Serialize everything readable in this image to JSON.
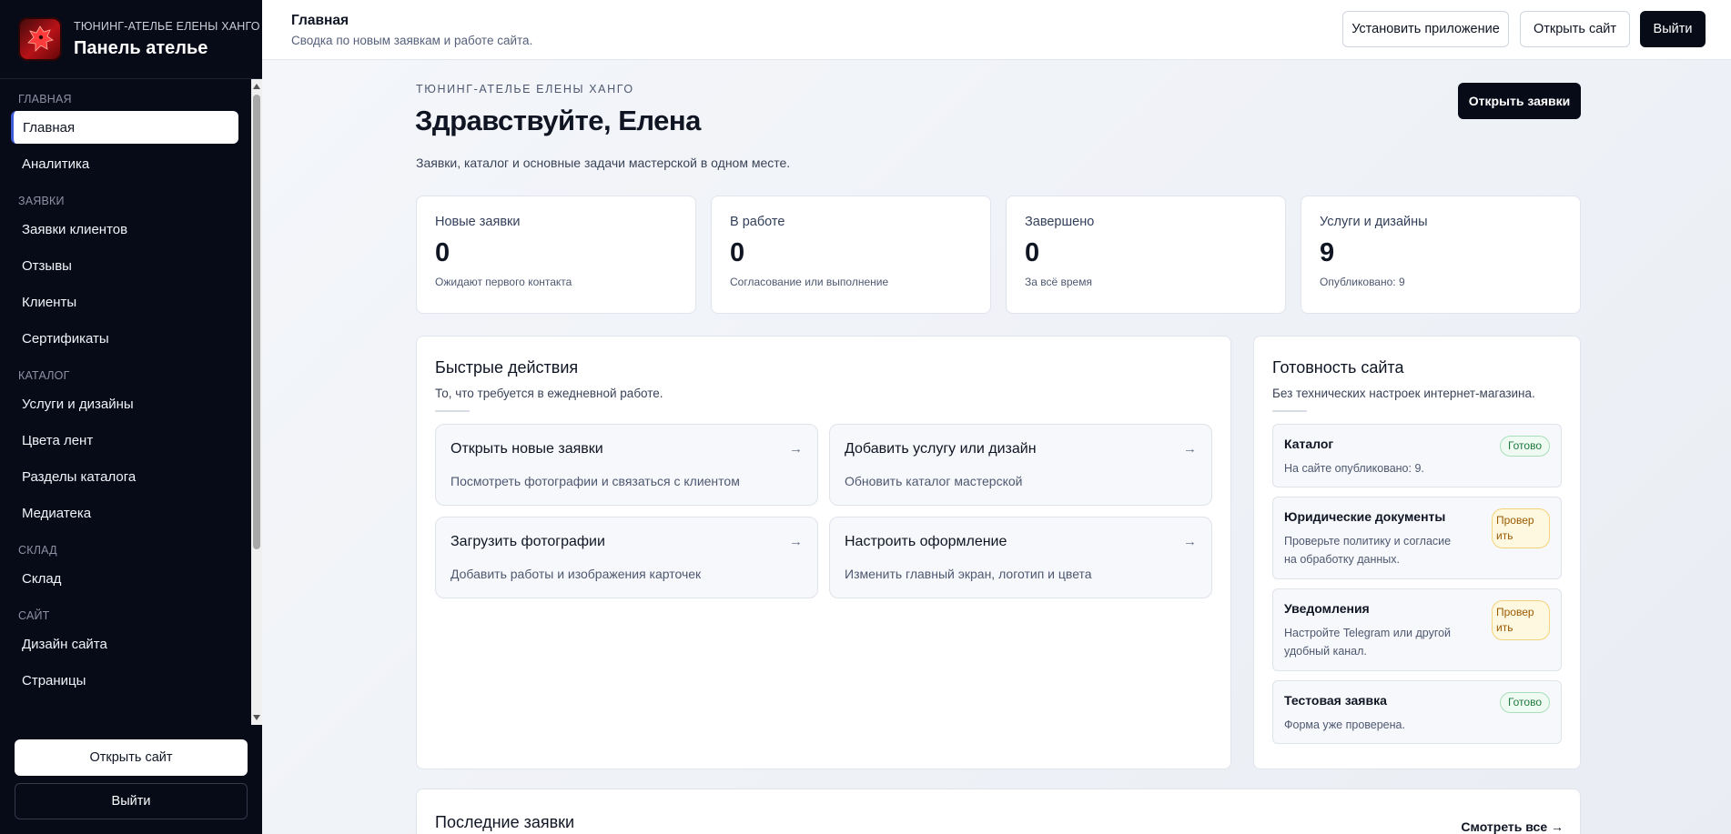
{
  "brand": {
    "subtitle": "ТЮНИНГ-АТЕЛЬЕ ЕЛЕНЫ ХАНГО",
    "title": "Панель ателье"
  },
  "sidebar": {
    "sections": [
      {
        "label": "ГЛАВНАЯ",
        "items": [
          "Главная",
          "Аналитика"
        ]
      },
      {
        "label": "ЗАЯВКИ",
        "items": [
          "Заявки клиентов",
          "Отзывы",
          "Клиенты",
          "Сертификаты"
        ]
      },
      {
        "label": "КАТАЛОГ",
        "items": [
          "Услуги и дизайны",
          "Цвета лент",
          "Разделы каталога",
          "Медиатека"
        ]
      },
      {
        "label": "СКЛАД",
        "items": [
          "Склад"
        ]
      },
      {
        "label": "САЙТ",
        "items": [
          "Дизайн сайта",
          "Страницы"
        ]
      }
    ],
    "active_item": "Главная",
    "open_site": "Открыть сайт",
    "logout": "Выйти"
  },
  "header": {
    "title": "Главная",
    "subtitle": "Сводка по новым заявкам и работе сайта.",
    "install_app": "Установить приложение",
    "open_site": "Открыть сайт",
    "logout": "Выйти"
  },
  "hero": {
    "eyebrow": "ТЮНИНГ-АТЕЛЬЕ ЕЛЕНЫ ХАНГО",
    "greeting": "Здравствуйте, Елена",
    "intro": "Заявки, каталог и основные задачи мастерской в одном месте.",
    "open_requests": "Открыть заявки"
  },
  "stats": [
    {
      "label": "Новые заявки",
      "value": "0",
      "hint": "Ожидают первого контакта"
    },
    {
      "label": "В работе",
      "value": "0",
      "hint": "Согласование или выполнение"
    },
    {
      "label": "Завершено",
      "value": "0",
      "hint": "За всё время"
    },
    {
      "label": "Услуги и дизайны",
      "value": "9",
      "hint": "Опубликовано: 9"
    }
  ],
  "quick_actions": {
    "title": "Быстрые действия",
    "subtitle": "То, что требуется в ежедневной работе.",
    "items": [
      {
        "title": "Открыть новые заявки",
        "subtitle": "Посмотреть фотографии и связаться с клиентом",
        "arrow": "→"
      },
      {
        "title": "Добавить услугу или дизайн",
        "subtitle": "Обновить каталог мастерской",
        "arrow": "→"
      },
      {
        "title": "Загрузить фотографии",
        "subtitle": "Добавить работы и изображения карточек",
        "arrow": "→"
      },
      {
        "title": "Настроить оформление",
        "subtitle": "Изменить главный экран, логотип и цвета",
        "arrow": "→"
      }
    ]
  },
  "readiness": {
    "title": "Готовность сайта",
    "subtitle": "Без технических настроек интернет-магазина.",
    "items": [
      {
        "title": "Каталог",
        "subtitle": "На сайте опубликовано: 9.",
        "status": "Готово",
        "kind": "ok"
      },
      {
        "title": "Юридические документы",
        "subtitle": "Проверьте политику и согласие на обработку данных.",
        "status": "Провер ить",
        "kind": "warn"
      },
      {
        "title": "Уведомления",
        "subtitle": "Настройте Telegram или другой удобный канал.",
        "status": "Провер ить",
        "kind": "warn"
      },
      {
        "title": "Тестовая заявка",
        "subtitle": "Форма уже проверена.",
        "status": "Готово",
        "kind": "ok"
      }
    ]
  },
  "latest": {
    "title": "Последние заявки",
    "view_all": "Смотреть все →"
  },
  "colors": {
    "sidebar_bg": "#070b18",
    "ok_badge": "#1d7a3c",
    "warn_badge": "#9a5a00",
    "active_marker": "#3f5bd6"
  }
}
